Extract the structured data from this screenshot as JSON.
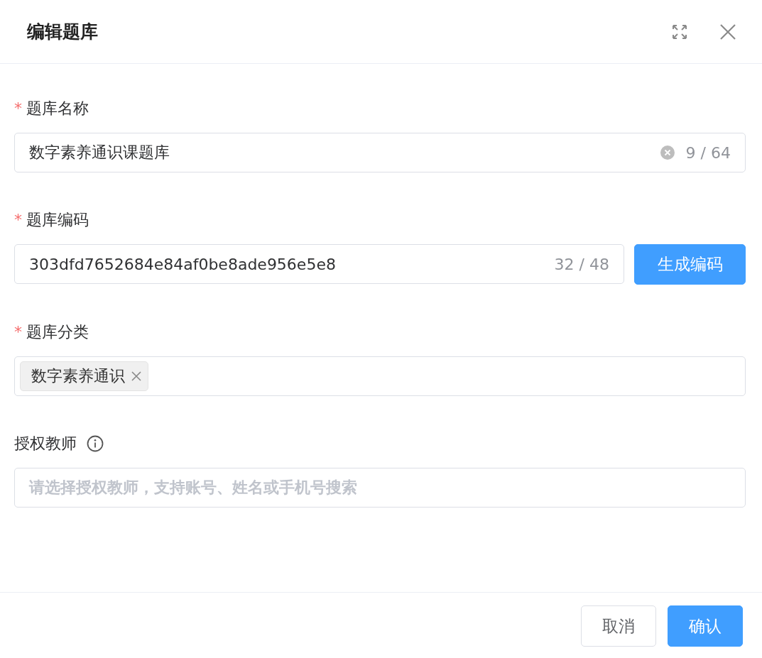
{
  "dialog": {
    "title": "编辑题库"
  },
  "fields": [
    {
      "kind": "text",
      "label": "题库名称",
      "required": true,
      "required_mark": "*",
      "value": "数字素养通识课题库",
      "clearable": true,
      "count": "9 / 64"
    },
    {
      "kind": "code",
      "label": "题库编码",
      "required": true,
      "required_mark": "*",
      "value": "303dfd7652684e84af0be8ade956e5e8",
      "count": "32 / 48",
      "button": "生成编码"
    },
    {
      "kind": "tags",
      "label": "题库分类",
      "required": true,
      "required_mark": "*",
      "tags": [
        "数字素养通识"
      ]
    },
    {
      "kind": "select",
      "label": "授权教师",
      "required": false,
      "info": true,
      "placeholder": "请选择授权教师，支持账号、姓名或手机号搜索"
    }
  ],
  "buttons": [
    {
      "label": "取消",
      "kind": "default"
    },
    {
      "label": "确认",
      "kind": "primary"
    }
  ]
}
